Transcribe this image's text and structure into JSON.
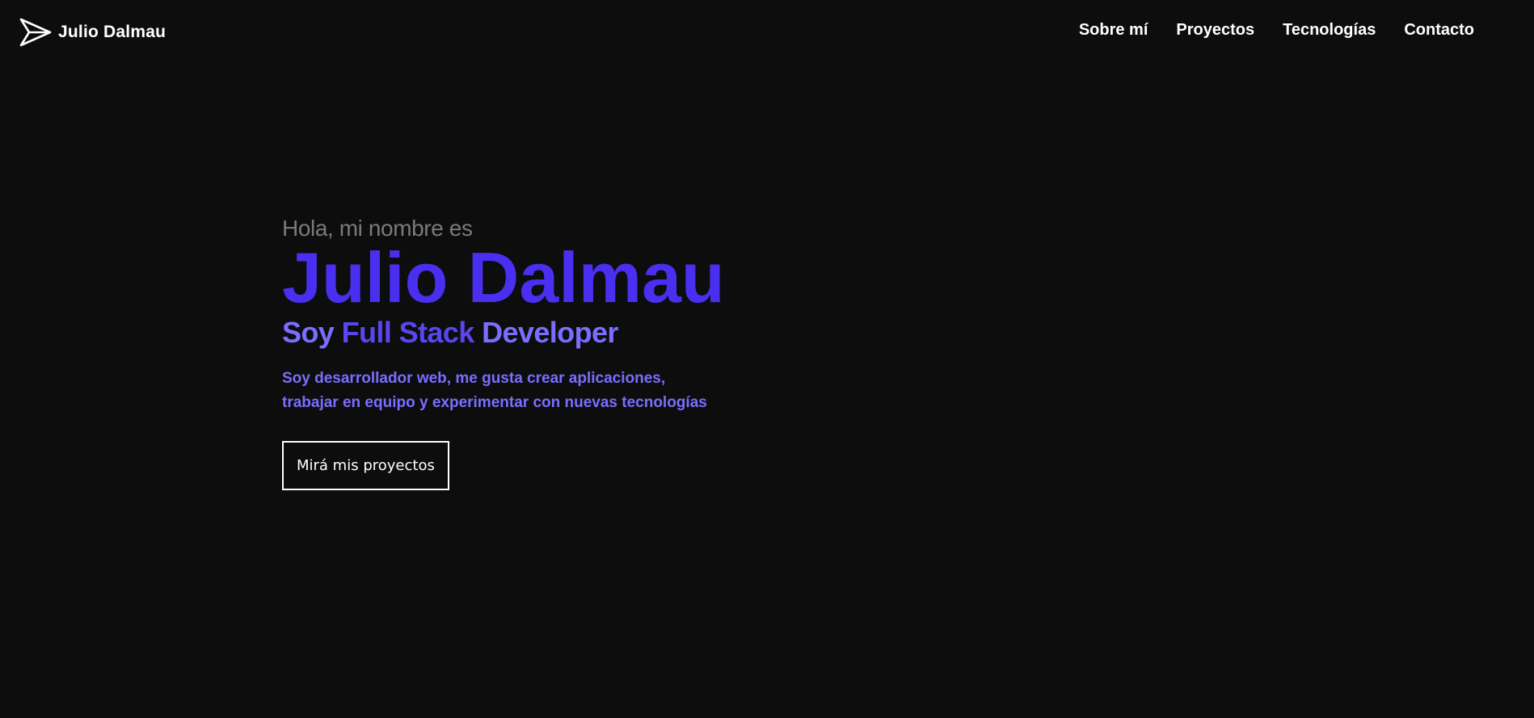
{
  "header": {
    "brand": "Julio Dalmau",
    "brand_icon": "paper-plane-icon",
    "nav": [
      {
        "label": "Sobre mí"
      },
      {
        "label": "Proyectos"
      },
      {
        "label": "Tecnologías"
      },
      {
        "label": "Contacto"
      }
    ]
  },
  "hero": {
    "greeting": "Hola, mi nombre es",
    "name": "Julio Dalmau",
    "tagline_prefix": "Soy",
    "tagline_highlight": "Full Stack",
    "tagline_suffix": "Developer",
    "description": "Soy desarrollador web, me gusta crear aplicaciones, trabajar en equipo y experimentar con nuevas tecnologías",
    "cta_label": "Mirá mis proyectos"
  },
  "colors": {
    "background": "#0d0d0d",
    "accent": "#4a2ff0",
    "accent_light": "#7b6dff",
    "muted": "#7a7a7a",
    "text": "#ffffff"
  }
}
